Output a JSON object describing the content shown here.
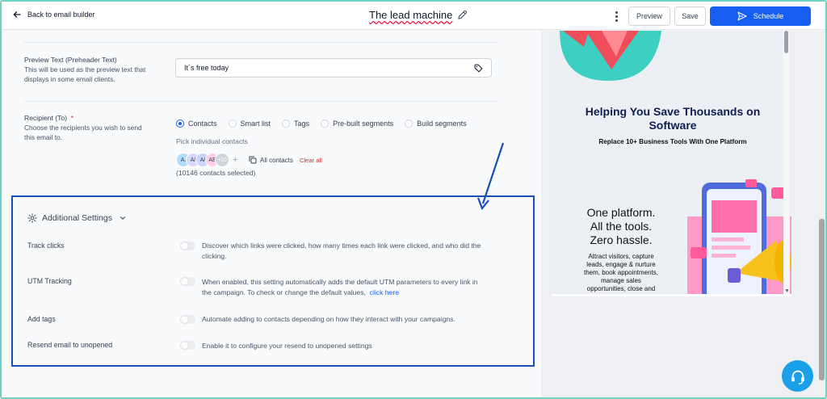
{
  "topbar": {
    "back_label": "Back to email builder",
    "title": "The lead machine",
    "preview_label": "Preview",
    "save_label": "Save",
    "schedule_label": "Schedule"
  },
  "preheader": {
    "label": "Preview Text (Preheader Text)",
    "desc_line1": "This will be used as the preview text that",
    "desc_line2": "displays in some email clients.",
    "value": "It´s free today"
  },
  "recipient": {
    "label": "Recipient (To)",
    "required_mark": "*",
    "desc_line1": "Choose the recipients you wish to send",
    "desc_line2": "this email to.",
    "options": [
      "Contacts",
      "Smart list",
      "Tags",
      "Pre-built segments",
      "Build segments"
    ],
    "selected_option": "Contacts",
    "pick_label": "Pick individual contacts",
    "avatars": [
      "A.",
      "A/",
      "A/",
      "AE",
      "+10"
    ],
    "add_symbol": "+",
    "all_contacts_label": "All contacts",
    "clear_all_label": "Clear all",
    "selected_count": "(10146 contacts selected)"
  },
  "additional": {
    "title": "Additional Settings",
    "rows": [
      {
        "label": "Track clicks",
        "desc_line1": "Discover which links were clicked, how many times each link were clicked, and who did the",
        "desc_line2": "clicking.",
        "enabled": false
      },
      {
        "label": "UTM Tracking",
        "desc_line1": "When enabled, this setting automatically adds the default UTM parameters to every link in",
        "desc_line2": "the campaign. To check or change the default values,",
        "link": "click here",
        "enabled": false
      },
      {
        "label": "Add tags",
        "desc_line1": "Automate adding to contacts depending on how they interact with your campaigns.",
        "enabled": false
      },
      {
        "label": "Resend email to unopened",
        "desc_line1": "Enable it to configure your resend to unopened settings",
        "enabled": false
      }
    ]
  },
  "email_preview": {
    "headline_line1": "Helping You Save Thousands on",
    "headline_line2": "Software",
    "subheadline": "Replace 10+ Business Tools With One Platform",
    "tagline_line1": "One platform.",
    "tagline_line2": "All the tools.",
    "tagline_line3": "Zero hassle.",
    "body_line1": "Attract visitors, capture",
    "body_line2": "leads, engage & nurture",
    "body_line3": "them, book appointments,",
    "body_line4": "manage sales",
    "body_line5": "opportunities, close and"
  },
  "colors": {
    "accent": "#155eef",
    "annotation": "#1a4fb8",
    "danger": "#d92d20",
    "support": "#1aa0e8"
  }
}
